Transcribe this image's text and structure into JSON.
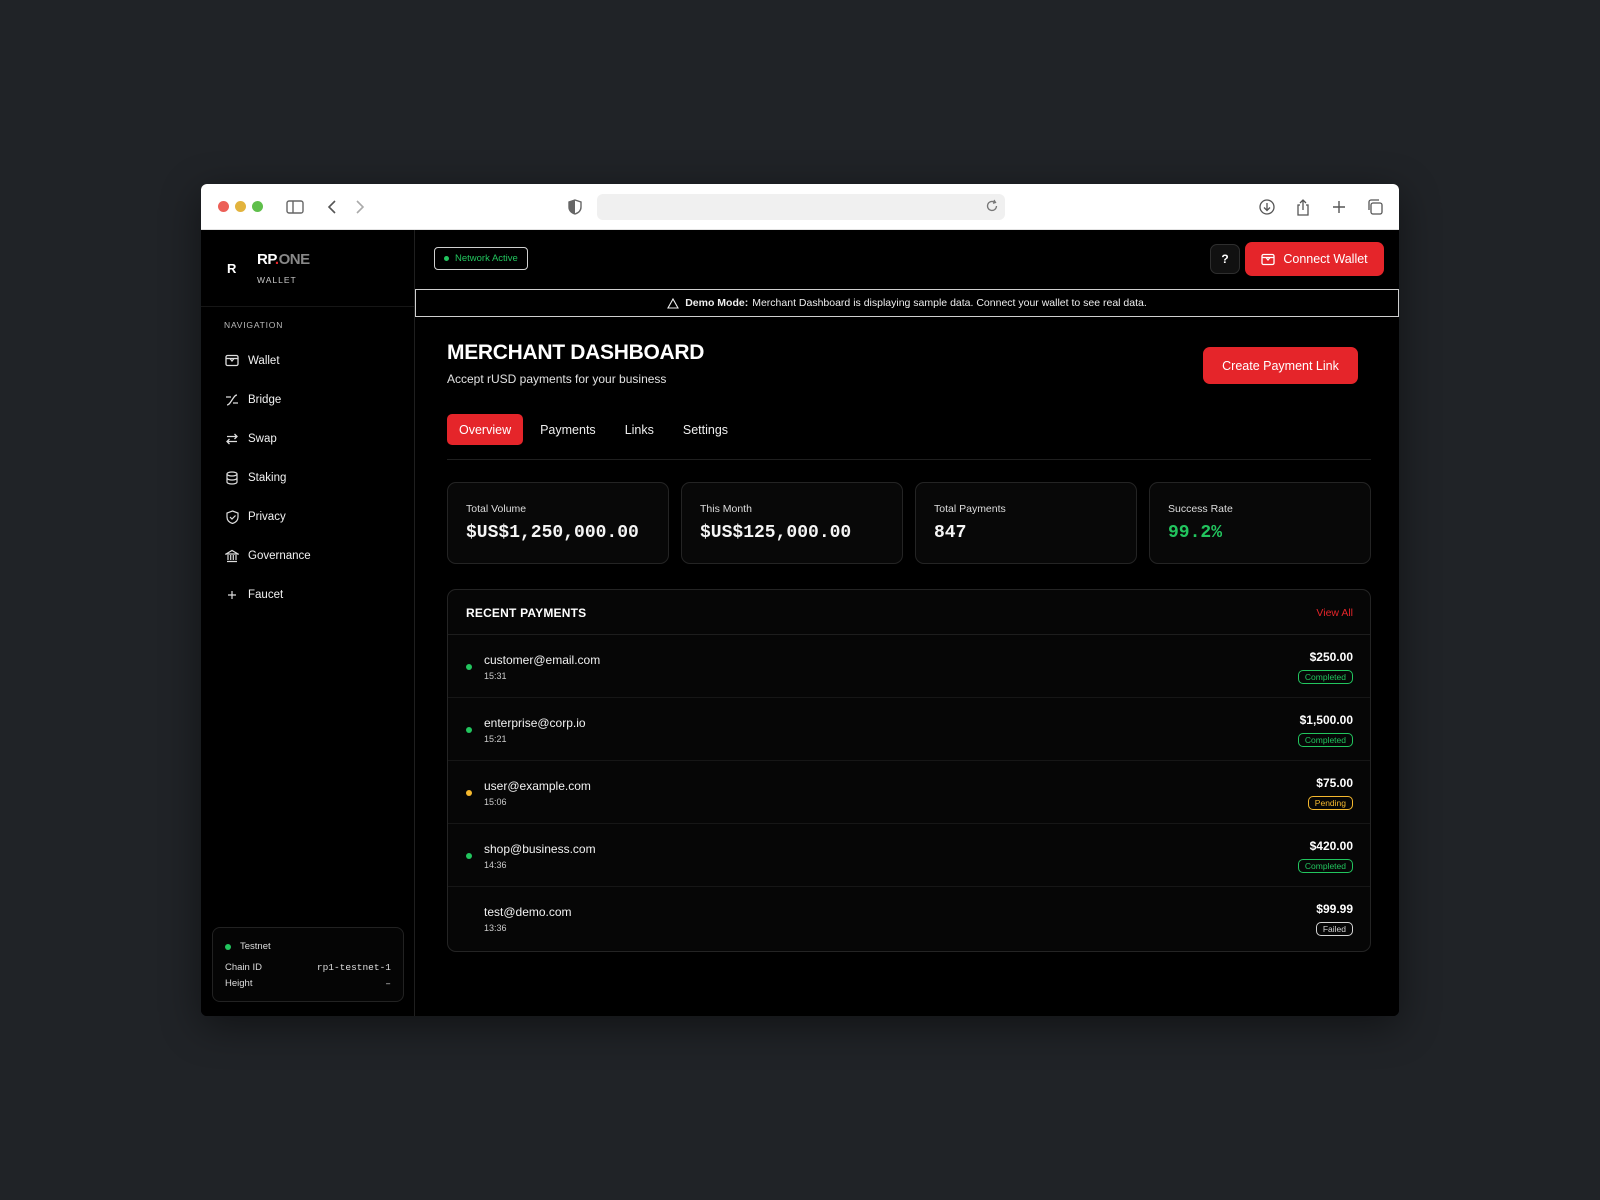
{
  "colors": {
    "accent": "#e5252a",
    "success": "#22c55e",
    "pending": "#f5b82e",
    "failed": "#d4d4d4"
  },
  "brand": {
    "logo_letter": "R",
    "name_rp": "RP",
    "name_dot": ".",
    "name_one": "ONE",
    "sub": "WALLET"
  },
  "sidebar": {
    "nav_title": "NAVIGATION",
    "items": [
      {
        "label": "Wallet",
        "icon": "wallet-icon"
      },
      {
        "label": "Bridge",
        "icon": "bridge-icon"
      },
      {
        "label": "Swap",
        "icon": "swap-icon"
      },
      {
        "label": "Staking",
        "icon": "database-icon"
      },
      {
        "label": "Privacy",
        "icon": "shield-check-icon"
      },
      {
        "label": "Governance",
        "icon": "bank-icon"
      },
      {
        "label": "Faucet",
        "icon": "plus-icon"
      }
    ],
    "network": {
      "name": "Testnet",
      "chain_label": "Chain ID",
      "chain_value": "rp1-testnet-1",
      "height_label": "Height",
      "height_value": "–"
    }
  },
  "header": {
    "network_status": "Network Active",
    "help": "?",
    "connect": "Connect Wallet"
  },
  "banner": {
    "bold": "Demo Mode:",
    "text": "Merchant Dashboard is displaying sample data. Connect your wallet to see real data."
  },
  "page": {
    "title": "MERCHANT DASHBOARD",
    "subtitle": "Accept rUSD payments for your business",
    "create": "Create Payment Link"
  },
  "tabs": [
    "Overview",
    "Payments",
    "Links",
    "Settings"
  ],
  "stats": [
    {
      "label": "Total Volume",
      "value": "$US$1,250,000.00"
    },
    {
      "label": "This Month",
      "value": "$US$125,000.00"
    },
    {
      "label": "Total Payments",
      "value": "847"
    },
    {
      "label": "Success Rate",
      "value": "99.2%"
    }
  ],
  "recent": {
    "title": "RECENT PAYMENTS",
    "view_all": "View All",
    "rows": [
      {
        "email": "customer@email.com",
        "time": "15:31",
        "amount": "$250.00",
        "status": "Completed"
      },
      {
        "email": "enterprise@corp.io",
        "time": "15:21",
        "amount": "$1,500.00",
        "status": "Completed"
      },
      {
        "email": "user@example.com",
        "time": "15:06",
        "amount": "$75.00",
        "status": "Pending"
      },
      {
        "email": "shop@business.com",
        "time": "14:36",
        "amount": "$420.00",
        "status": "Completed"
      },
      {
        "email": "test@demo.com",
        "time": "13:36",
        "amount": "$99.99",
        "status": "Failed"
      }
    ]
  }
}
